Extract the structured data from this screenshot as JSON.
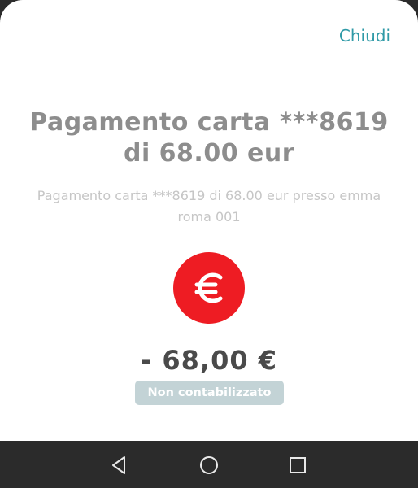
{
  "header": {
    "close_label": "Chiudi"
  },
  "transaction": {
    "title": "Pagamento carta ***8619 di 68.00 eur",
    "description": "Pagamento carta ***8619 di 68.00 eur presso emma roma 001",
    "amount": "- 68,00 €",
    "status": "Non contabilizzato",
    "icon": "euro-icon"
  },
  "colors": {
    "accent": "#2f9aa7",
    "icon_bg": "#ee1c23",
    "badge_bg": "#c3d3d6"
  },
  "navbar": {
    "buttons": [
      "back-icon",
      "home-icon",
      "recent-apps-icon"
    ]
  }
}
